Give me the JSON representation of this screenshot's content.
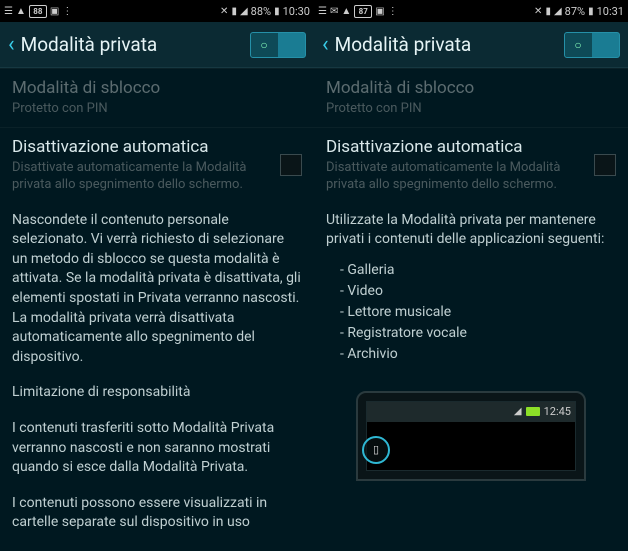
{
  "left": {
    "status": {
      "batt_num": "88",
      "batt_pct": "88%",
      "time": "10:30"
    },
    "header_title": "Modalità privata",
    "unlock": {
      "title": "Modalità di sblocco",
      "sub": "Protetto con PIN"
    },
    "auto_off": {
      "title": "Disattivazione automatica",
      "sub": "Disattivate automaticamente la Modalità privata allo spegnimento dello schermo."
    },
    "para1": "Nascondete il contenuto personale selezionato. Vi verrà richiesto di selezionare un metodo di sblocco se questa modalità è attivata. Se la modalità privata è disattivata, gli elementi spostati in Privata verranno nascosti.",
    "para2": "La modalità privata verrà disattivata automaticamente allo spegnimento del dispositivo.",
    "para3": "Limitazione di responsabilità",
    "para4": "I contenuti trasferiti sotto Modalità Privata verranno nascosti e non saranno mostrati quando si esce dalla Modalità Privata.",
    "para5": "I contenuti possono essere visualizzati in cartelle separate sul dispositivo in uso"
  },
  "right": {
    "status": {
      "batt_num": "87",
      "batt_pct": "87%",
      "time": "10:31"
    },
    "header_title": "Modalità privata",
    "unlock": {
      "title": "Modalità di sblocco",
      "sub": "Protetto con PIN"
    },
    "auto_off": {
      "title": "Disattivazione automatica",
      "sub": "Disattivate automaticamente la Modalità privata allo spegnimento dello schermo."
    },
    "intro": "Utilizzate la Modalità privata per mantenere privati i contenuti delle applicazioni seguenti:",
    "list": [
      "Galleria",
      "Video",
      "Lettore musicale",
      "Registratore vocale",
      "Archivio"
    ],
    "phone_time": "12:45"
  }
}
